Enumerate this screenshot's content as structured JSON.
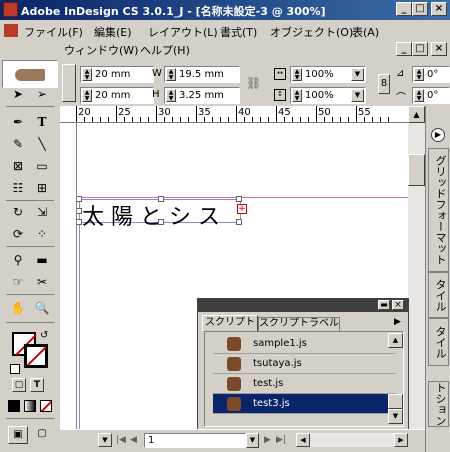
{
  "window": {
    "title": "Adobe InDesign CS 3.0.1_J - [名称未設定-3 @ 300%]",
    "minimize": "_",
    "maximize": "□",
    "close": "×"
  },
  "menu": {
    "row1": [
      "ファイル(F)",
      "編集(E)",
      "レイアウト(L)",
      "書式(T)",
      "オブジェクト(O)",
      "表(A)"
    ],
    "row2": [
      "ウィンドウ(W)",
      "ヘルプ(H)"
    ]
  },
  "control_panel": {
    "x_value": "20 mm",
    "y_value": "20 mm",
    "w_label": "W",
    "h_label": "H",
    "w_value": "19.5 mm",
    "h_value": "3.25 mm",
    "scale_x": "100%",
    "scale_y": "100%",
    "angle": "0°",
    "shear": "0°"
  },
  "ruler": {
    "ticks": [
      "20",
      "25",
      "30",
      "35",
      "40",
      "45",
      "50",
      "55"
    ]
  },
  "canvas": {
    "text_frame_content": "太陽とシス"
  },
  "side_tabs": {
    "tab1": "グリッドフォーマット",
    "tab2": "タイル",
    "tab3": "タイル",
    "tab4": "トション"
  },
  "script_panel": {
    "tabs": [
      "スクリプト",
      "スクリプトラベル"
    ],
    "items": [
      "sample1.js",
      "tsutaya.js",
      "test.js",
      "test3.js"
    ],
    "selected_index": 3
  },
  "status": {
    "page_number": "1"
  },
  "colors": {
    "title_bar": "#0a246a",
    "selection": "#0a246a",
    "frame_edge": "#8a8ad0",
    "overset": "#cc0000"
  }
}
